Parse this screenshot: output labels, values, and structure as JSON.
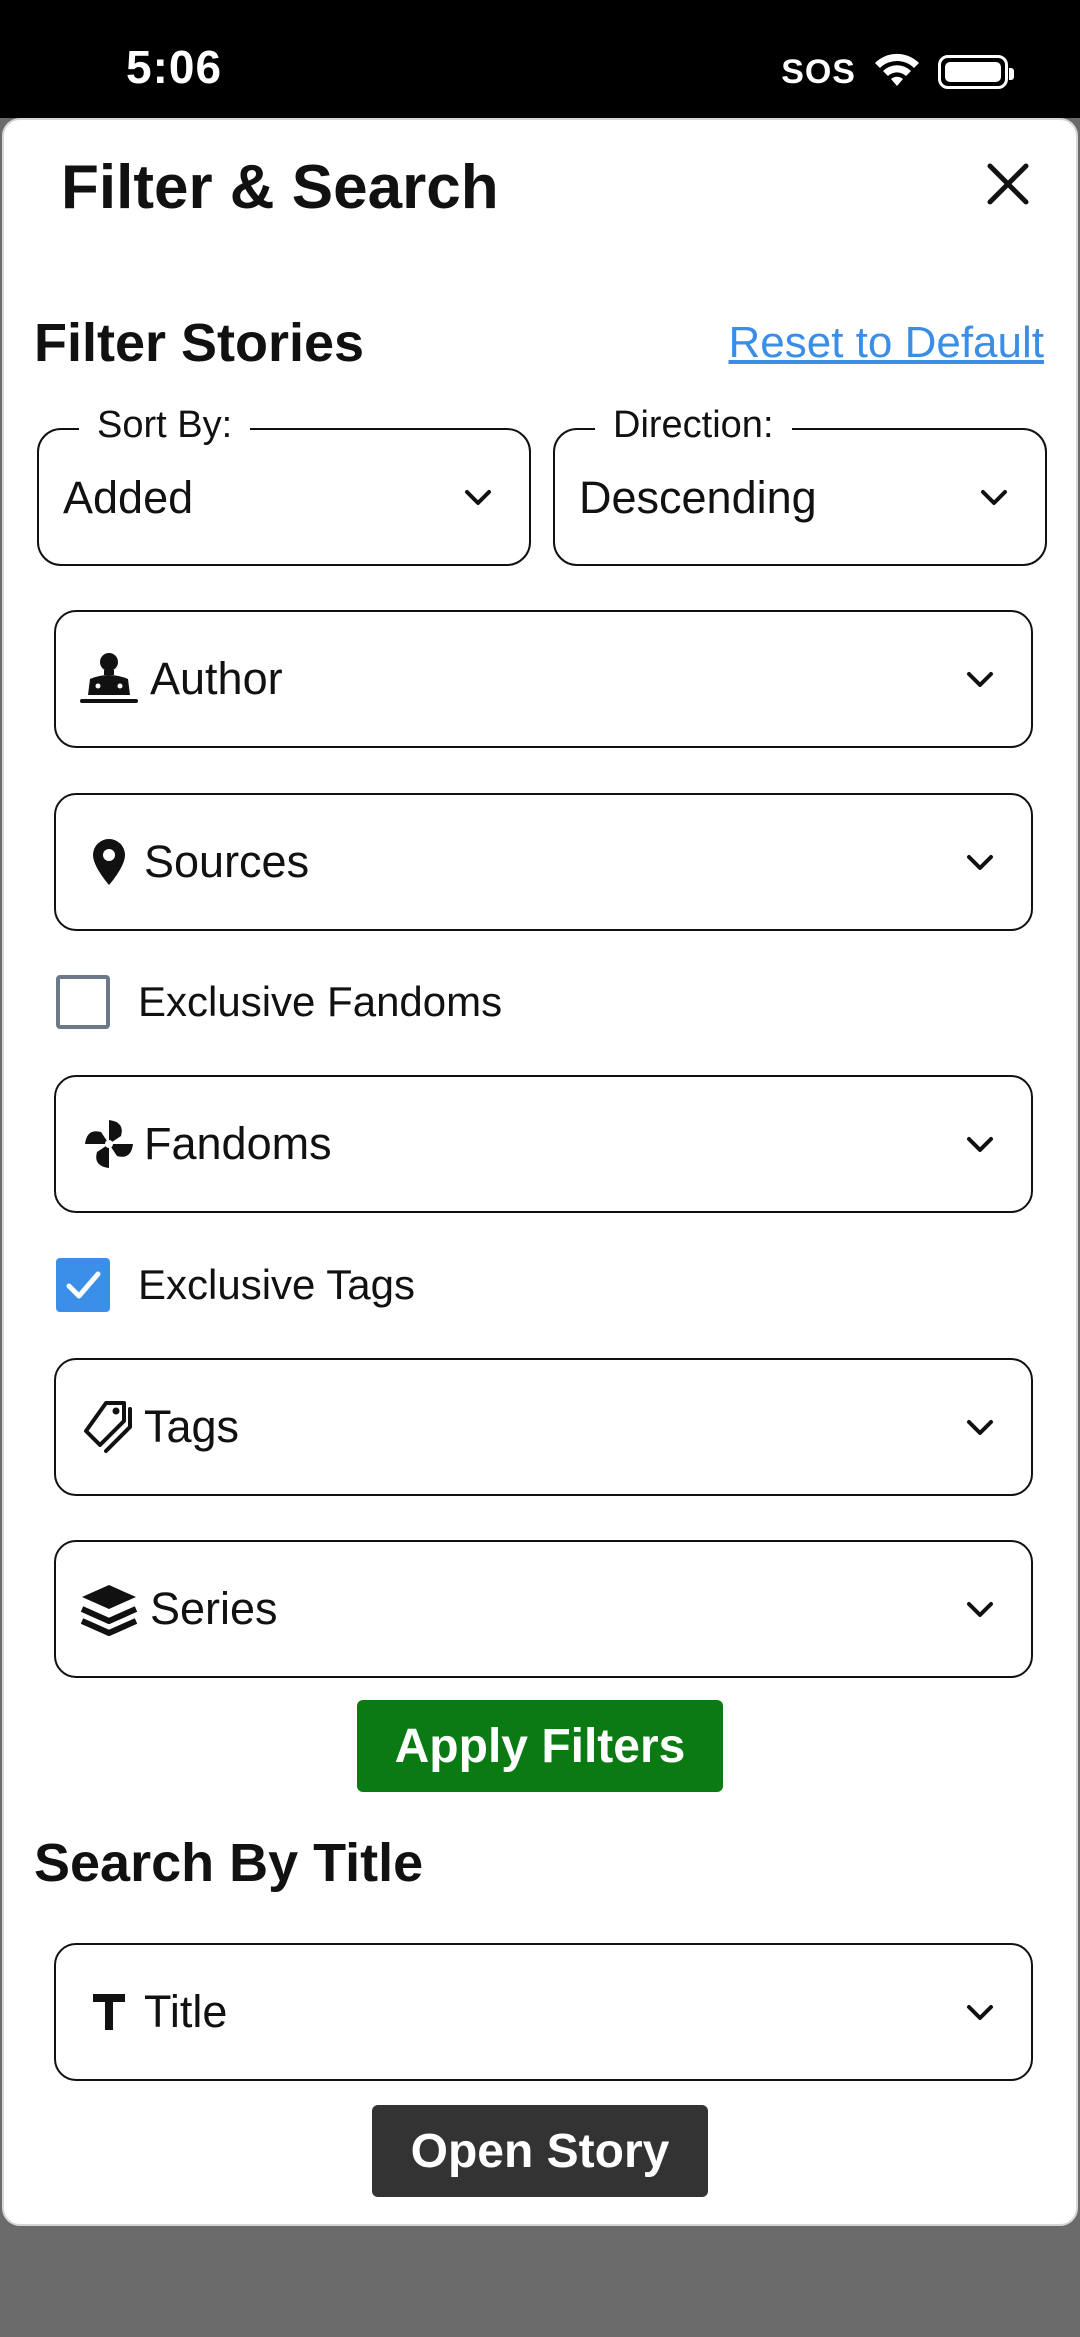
{
  "status": {
    "time": "5:06",
    "sos": "SOS"
  },
  "modal": {
    "title": "Filter & Search",
    "filter_section": "Filter Stories",
    "reset_label": "Reset to Default",
    "sort_by": {
      "legend": "Sort By:",
      "value": "Added"
    },
    "direction": {
      "legend": "Direction:",
      "value": "Descending"
    },
    "author": {
      "label": "Author",
      "icon": "author-icon"
    },
    "sources": {
      "label": "Sources",
      "icon": "map-pin-icon"
    },
    "exclusive_fandoms": {
      "label": "Exclusive Fandoms",
      "checked": false
    },
    "fandoms": {
      "label": "Fandoms",
      "icon": "pinwheel-icon"
    },
    "exclusive_tags": {
      "label": "Exclusive Tags",
      "checked": true
    },
    "tags": {
      "label": "Tags",
      "icon": "tags-icon"
    },
    "series": {
      "label": "Series",
      "icon": "layers-icon"
    },
    "apply_label": "Apply Filters",
    "search_section": "Search By Title",
    "title_field": {
      "label": "Title",
      "icon": "text-icon"
    },
    "open_label": "Open Story"
  },
  "colors": {
    "apply_button": "#0a7a12",
    "open_button": "#333333",
    "link": "#3a8ee6",
    "checkbox_checked": "#3b8fe8"
  }
}
